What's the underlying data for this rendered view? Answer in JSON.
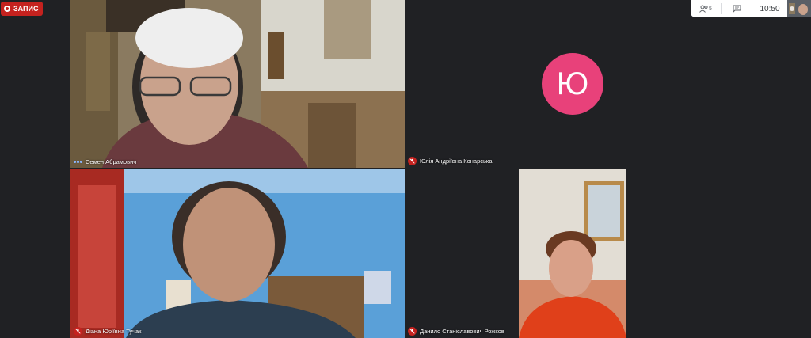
{
  "recording": {
    "label": "ЗАПИС"
  },
  "participants": [
    {
      "name": "Семен Абрамович",
      "status": "speaking"
    },
    {
      "name": "Юлія Андріївна Конарська",
      "status": "muted",
      "avatar_letter": "Ю",
      "avatar_color": "#e8417a"
    },
    {
      "name": "Діана Юріївна Тучак",
      "status": "muted"
    },
    {
      "name": "Данило Станіславович Рожков",
      "status": "muted"
    }
  ],
  "topbar": {
    "people_count": "5",
    "time": "10:50",
    "people_icon": "people-icon",
    "chat_icon": "chat-icon"
  },
  "colors": {
    "background": "#202124",
    "muted": "#c5221f",
    "speaking": "#8ab4f8"
  }
}
